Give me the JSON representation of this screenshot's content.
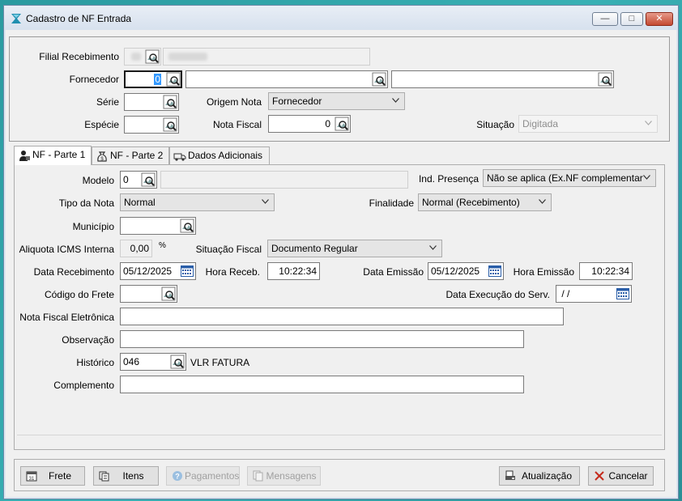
{
  "window": {
    "title": "Cadastro de NF Entrada",
    "controls": {
      "minimize": "—",
      "maximize": "□",
      "close": "✕"
    }
  },
  "header": {
    "filial": {
      "label": "Filial Recebimento"
    },
    "fornecedor": {
      "label": "Fornecedor",
      "code": "0"
    },
    "serie": {
      "label": "Série",
      "value": ""
    },
    "origem": {
      "label": "Origem Nota",
      "value": "Fornecedor"
    },
    "especie": {
      "label": "Espécie",
      "value": ""
    },
    "nota_fiscal": {
      "label": "Nota Fiscal",
      "value": "0"
    },
    "situacao": {
      "label": "Situação",
      "value": "Digitada"
    }
  },
  "tabs": [
    {
      "label": "NF - Parte 1",
      "icon": "person-icon"
    },
    {
      "label": "NF - Parte 2",
      "icon": "money-bag-icon"
    },
    {
      "label": "Dados Adicionais",
      "icon": "truck-icon"
    }
  ],
  "form": {
    "modelo": {
      "label": "Modelo",
      "value": "0"
    },
    "ind_presenca": {
      "label": "Ind. Presença",
      "value": "Não se aplica (Ex.NF complementar"
    },
    "tipo_nota": {
      "label": "Tipo da Nota",
      "value": "Normal"
    },
    "finalidade": {
      "label": "Finalidade",
      "value": "Normal (Recebimento)"
    },
    "municipio": {
      "label": "Município",
      "value": ""
    },
    "aliquota": {
      "label": "Aliquota ICMS Interna",
      "value": "0,00",
      "unit": "%"
    },
    "situacao_fiscal": {
      "label": "Situação Fiscal",
      "value": "Documento Regular"
    },
    "data_recebimento": {
      "label": "Data Recebimento",
      "value": "05/12/2025"
    },
    "hora_receb": {
      "label": "Hora Receb.",
      "value": "10:22:34"
    },
    "data_emissao": {
      "label": "Data Emissão",
      "value": "05/12/2025"
    },
    "hora_emissao": {
      "label": "Hora Emissão",
      "value": "10:22:34"
    },
    "codigo_frete": {
      "label": "Código do Frete",
      "value": ""
    },
    "data_execucao": {
      "label": "Data Execução do Serv.",
      "value": " / /"
    },
    "nfe": {
      "label": "Nota Fiscal Eletrônica",
      "value": ""
    },
    "observacao": {
      "label": "Observação",
      "value": ""
    },
    "historico": {
      "label": "Histórico",
      "code": "046",
      "description": "VLR FATURA"
    },
    "complemento": {
      "label": "Complemento",
      "value": ""
    }
  },
  "footer": {
    "frete": "Frete",
    "itens": "Itens",
    "pagamentos": "Pagamentos",
    "mensagens": "Mensagens",
    "atualizacao": "Atualização",
    "cancelar": "Cancelar"
  }
}
